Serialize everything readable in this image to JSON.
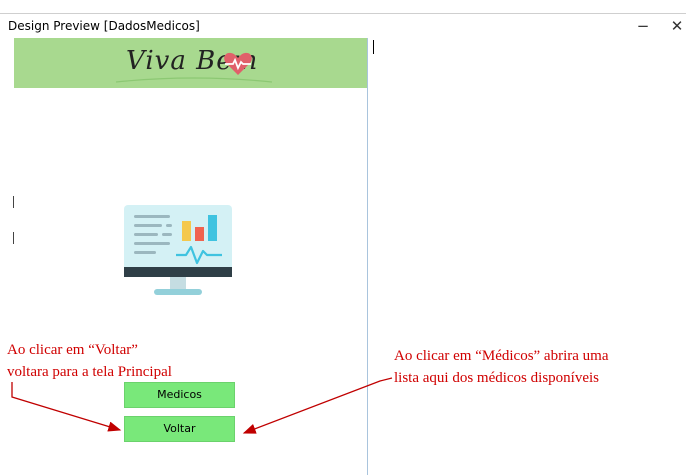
{
  "window": {
    "title": "Design Preview [DadosMedicos]",
    "minimize_glyph": "−",
    "close_glyph": "✕"
  },
  "header": {
    "logo_text": "Viva Bem",
    "logo_icon": "heart-pulse-icon",
    "banner_color": "#a8d98f"
  },
  "illustration": {
    "icon": "monitor-dashboard-icon"
  },
  "buttons": {
    "medicos_label": "Medicos",
    "voltar_label": "Voltar",
    "color": "#79e87a"
  },
  "annotations": {
    "left": {
      "line1": "Ao clicar em “Voltar”",
      "line2": "voltara para a tela Principal"
    },
    "right": {
      "line1": "Ao clicar em “Médicos” abrira uma",
      "line2": "lista aqui dos médicos disponíveis"
    },
    "color": "#d00000"
  }
}
